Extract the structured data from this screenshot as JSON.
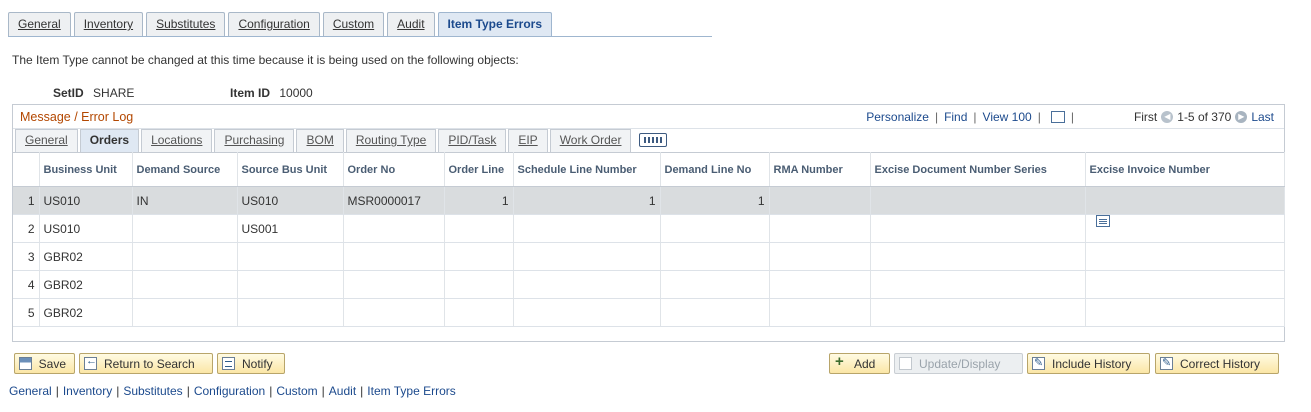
{
  "page_tabs": [
    "General",
    "Inventory",
    "Substitutes",
    "Configuration",
    "Custom",
    "Audit",
    "Item Type Errors"
  ],
  "active_page_tab": "Item Type Errors",
  "info_text": "The Item Type cannot be changed at this time because it is being used on the following objects:",
  "setid": {
    "label": "SetID",
    "value": "SHARE"
  },
  "item_id": {
    "label": "Item ID",
    "value": "10000"
  },
  "grid": {
    "title": "Message / Error Log",
    "personalize": "Personalize",
    "find": "Find",
    "view": "View 100",
    "first": "First",
    "range": "1-5 of 370",
    "last": "Last",
    "tabs": [
      "General",
      "Orders",
      "Locations",
      "Purchasing",
      "BOM",
      "Routing Type",
      "PID/Task",
      "EIP",
      "Work Order"
    ],
    "active_tab": "Orders",
    "columns": [
      "Business Unit",
      "Demand Source",
      "Source Bus Unit",
      "Order No",
      "Order Line",
      "Schedule Line Number",
      "Demand Line No",
      "RMA Number",
      "Excise Document Number Series",
      "Excise Invoice Number"
    ],
    "rows": [
      {
        "n": "1",
        "bu": "US010",
        "demand_source": "IN",
        "source_bu": "US010",
        "order_no": "MSR0000017",
        "order_line": "1",
        "sched_line": "1",
        "demand_line": "1",
        "rma": "",
        "excise_series": "",
        "excise_invoice": ""
      },
      {
        "n": "2",
        "bu": "US010",
        "demand_source": "",
        "source_bu": "US001",
        "order_no": "",
        "order_line": "",
        "sched_line": "",
        "demand_line": "",
        "rma": "",
        "excise_series": "",
        "excise_invoice": ""
      },
      {
        "n": "3",
        "bu": "GBR02",
        "demand_source": "",
        "source_bu": "",
        "order_no": "",
        "order_line": "",
        "sched_line": "",
        "demand_line": "",
        "rma": "",
        "excise_series": "",
        "excise_invoice": ""
      },
      {
        "n": "4",
        "bu": "GBR02",
        "demand_source": "",
        "source_bu": "",
        "order_no": "",
        "order_line": "",
        "sched_line": "",
        "demand_line": "",
        "rma": "",
        "excise_series": "",
        "excise_invoice": ""
      },
      {
        "n": "5",
        "bu": "GBR02",
        "demand_source": "",
        "source_bu": "",
        "order_no": "",
        "order_line": "",
        "sched_line": "",
        "demand_line": "",
        "rma": "",
        "excise_series": "",
        "excise_invoice": ""
      }
    ]
  },
  "buttons": {
    "save": "Save",
    "return_to_search": "Return to Search",
    "notify": "Notify",
    "add": "Add",
    "update_display": "Update/Display",
    "include_history": "Include History",
    "correct_history": "Correct History"
  },
  "footer_links": [
    "General",
    "Inventory",
    "Substitutes",
    "Configuration",
    "Custom",
    "Audit",
    "Item Type Errors"
  ],
  "colors": {
    "grid_title": "#b34700",
    "link": "#1c4a8d",
    "selected_row": "#d9dcde",
    "button_bg": "#fbe6a6"
  }
}
